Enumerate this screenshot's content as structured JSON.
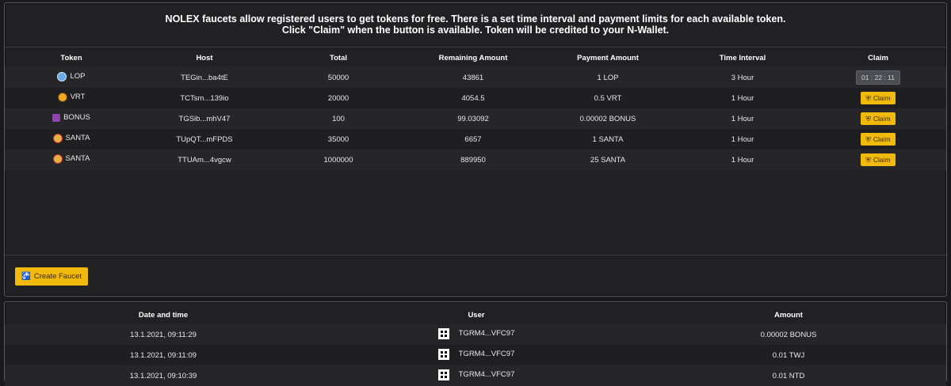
{
  "intro": {
    "line1": "NOLEX faucets allow registered users to get tokens for free. There is a set time interval and payment limits for each available token.",
    "line2": "Click \"Claim\" when the button is available. Token will be credited to your N-Wallet."
  },
  "faucet_table": {
    "headers": [
      "Token",
      "Host",
      "Total",
      "Remaining Amount",
      "Payment Amount",
      "Time Interval",
      "Claim"
    ],
    "rows": [
      {
        "token": "LOP",
        "icon": "lop-coin-icon",
        "icon_color": "#6aa8e8",
        "host": "TEGin...ba4tE",
        "total": "50000",
        "remaining": "43861",
        "payment": "1 LOP",
        "interval": "3 Hour",
        "claim": "01 : 22 : 11"
      },
      {
        "token": "VRT",
        "icon": "vrt-coin-icon",
        "icon_color": "#f5a623",
        "host": "TCTsm...139io",
        "total": "20000",
        "remaining": "4054.5",
        "payment": "0.5 VRT",
        "interval": "1 Hour",
        "claim": "Claim"
      },
      {
        "token": "BONUS",
        "icon": "bonus-coin-icon",
        "icon_color": "#8e44ad",
        "host": "TGSib...mhV47",
        "total": "100",
        "remaining": "99.03092",
        "payment": "0.00002 BONUS",
        "interval": "1 Hour",
        "claim": "Claim"
      },
      {
        "token": "SANTA",
        "icon": "santa-coin-icon",
        "icon_color": "#e8b04a",
        "host": "TUpQT...mFPDS",
        "total": "35000",
        "remaining": "6657",
        "payment": "1 SANTA",
        "interval": "1 Hour",
        "claim": "Claim"
      },
      {
        "token": "SANTA",
        "icon": "santa-coin-icon",
        "icon_color": "#e8b04a",
        "host": "TTUAm...4vgcw",
        "total": "1000000",
        "remaining": "889950",
        "payment": "25 SANTA",
        "interval": "1 Hour",
        "claim": "Claim"
      }
    ]
  },
  "create_faucet": {
    "label": "Create Faucet",
    "icon": "faucet-icon"
  },
  "history_table": {
    "headers": [
      "Date and time",
      "User",
      "Amount"
    ],
    "rows": [
      {
        "datetime": "13.1.2021, 09:11:29",
        "user": "TGRM4...VFC97",
        "amount": "0.00002 BONUS"
      },
      {
        "datetime": "13.1.2021, 09:11:09",
        "user": "TGRM4...VFC97",
        "amount": "0.01 TWJ"
      },
      {
        "datetime": "13.1.2021, 09:10:39",
        "user": "TGRM4...VFC97",
        "amount": "0.01 NTD"
      }
    ]
  },
  "colors": {
    "accent": "#f0b90b",
    "panel_bg": "#212123",
    "page_bg": "#1a1a1c"
  }
}
